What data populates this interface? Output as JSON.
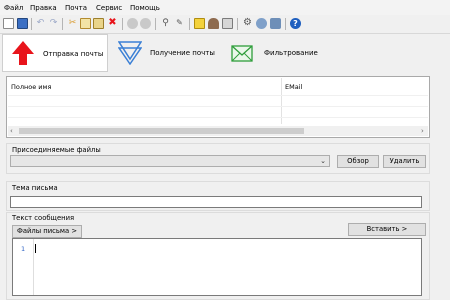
{
  "menu": [
    "Файл",
    "Правка",
    "Почта",
    "Сервис",
    "Помощь"
  ],
  "toolbar": {
    "icons": [
      "new-document-icon",
      "save-icon",
      "undo-icon",
      "redo-icon",
      "cut-icon",
      "copy-icon",
      "paste-icon",
      "delete-icon",
      "stop-icon",
      "refresh-icon",
      "find-icon",
      "address-book-icon",
      "note-icon",
      "user-icon",
      "accounts-icon",
      "settings-icon",
      "network-icon",
      "web-icon",
      "help-icon"
    ]
  },
  "modes": {
    "send": "Отправка почты",
    "receive": "Получение почты",
    "filter": "Фильтрование",
    "active": "send"
  },
  "contacts": {
    "columns": [
      "Полное имя",
      "EMail"
    ]
  },
  "attachments": {
    "label": "Присоединяемые файлы",
    "selected": "",
    "browse_button": "Обзор",
    "delete_button": "Удалить"
  },
  "subject": {
    "label": "Тема письма",
    "value": ""
  },
  "message": {
    "label": "Текст сообщения",
    "files_button": "Файлы письма >",
    "insert_button": "Вставить >",
    "line_number": "1"
  },
  "colors": {
    "accent_red": "#e8141b",
    "accent_blue": "#3a7fd5",
    "accent_green": "#2f9e3b",
    "help_blue": "#1f5fbf"
  }
}
